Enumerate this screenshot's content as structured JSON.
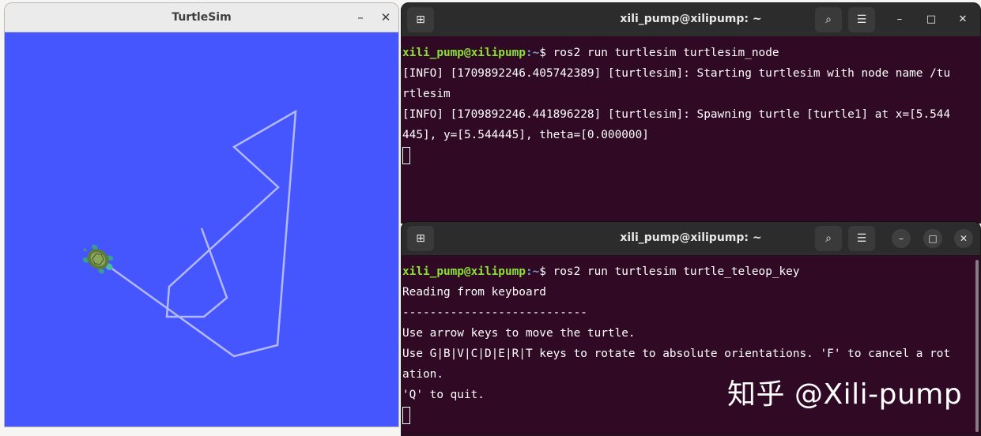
{
  "turtlesim_window": {
    "title": "TurtleSim",
    "minimize_glyph": "–",
    "close_glyph": "✕",
    "background_color": "#4556ff",
    "trail_color": "#b3b8ff",
    "turtle_icon": "turtle-icon"
  },
  "terminal1": {
    "title": "xili_pump@xilipump: ~",
    "new_tab_glyph": "⊞",
    "search_glyph": "⌕",
    "menu_glyph": "☰",
    "minimize_glyph": "–",
    "maximize_glyph": "□",
    "close_glyph": "✕",
    "prompt_user": "xili_pump@xilipump",
    "prompt_path": ":~",
    "command": "$ ros2 run turtlesim turtlesim_node",
    "output_lines": [
      "[INFO] [1709892246.405742389] [turtlesim]: Starting turtlesim with node name /tu",
      "rtlesim",
      "[INFO] [1709892246.441896228] [turtlesim]: Spawning turtle [turtle1] at x=[5.544",
      "445], y=[5.544445], theta=[0.000000]"
    ]
  },
  "terminal2": {
    "title": "xili_pump@xilipump: ~",
    "new_tab_glyph": "⊞",
    "search_glyph": "⌕",
    "menu_glyph": "☰",
    "minimize_glyph": "–",
    "maximize_glyph": "□",
    "close_glyph": "✕",
    "prompt_user": "xili_pump@xilipump",
    "prompt_path": ":~",
    "command": "$ ros2 run turtlesim turtle_teleop_key",
    "output_lines": [
      "Reading from keyboard",
      "---------------------------",
      "Use arrow keys to move the turtle.",
      "Use G|B|V|C|D|E|R|T keys to rotate to absolute orientations. 'F' to cancel a rot",
      "ation.",
      "'Q' to quit."
    ]
  },
  "watermark": "知乎 @Xili-pump"
}
